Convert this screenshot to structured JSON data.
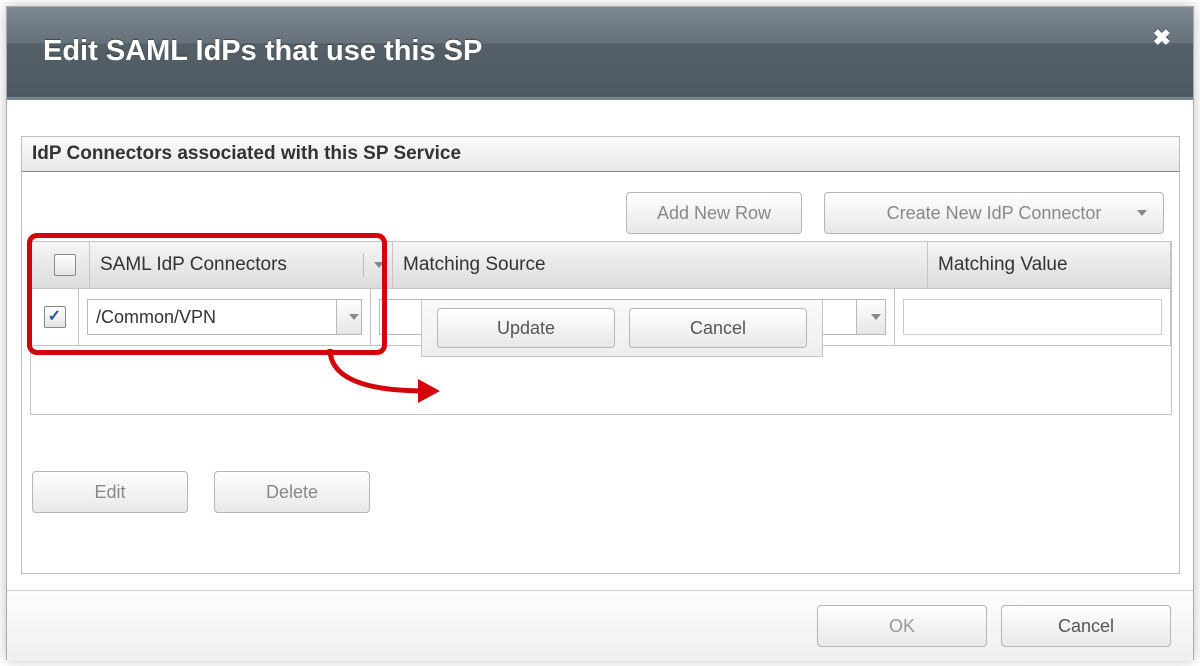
{
  "dialog": {
    "title": "Edit SAML IdPs that use this SP"
  },
  "section": {
    "label": "IdP Connectors associated with this SP Service"
  },
  "toolbar": {
    "add_row": "Add New Row",
    "create_connector": "Create New IdP Connector"
  },
  "grid": {
    "columns": {
      "connectors": "SAML IdP Connectors",
      "source": "Matching Source",
      "value": "Matching Value"
    },
    "rows": [
      {
        "checked": true,
        "connector": "/Common/VPN",
        "source": "",
        "value": ""
      }
    ],
    "row_actions": {
      "update": "Update",
      "cancel": "Cancel"
    }
  },
  "lower_actions": {
    "edit": "Edit",
    "delete": "Delete"
  },
  "footer": {
    "ok": "OK",
    "cancel": "Cancel"
  }
}
